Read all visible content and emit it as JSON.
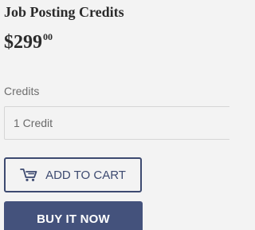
{
  "product": {
    "title": "Job Posting Credits",
    "price_main": "$299",
    "price_cents": "00"
  },
  "variant": {
    "label": "Credits",
    "selected": "1 Credit"
  },
  "actions": {
    "add_to_cart_label": "ADD TO CART",
    "add_to_cart_icon": "cart-icon",
    "buy_now_label": "BUY IT NOW"
  },
  "colors": {
    "background": "#f3f3f3",
    "accent": "#44527c",
    "outline_button": "#3d4a70",
    "text": "#2b2b2b",
    "muted_text": "#6e6e6e"
  }
}
